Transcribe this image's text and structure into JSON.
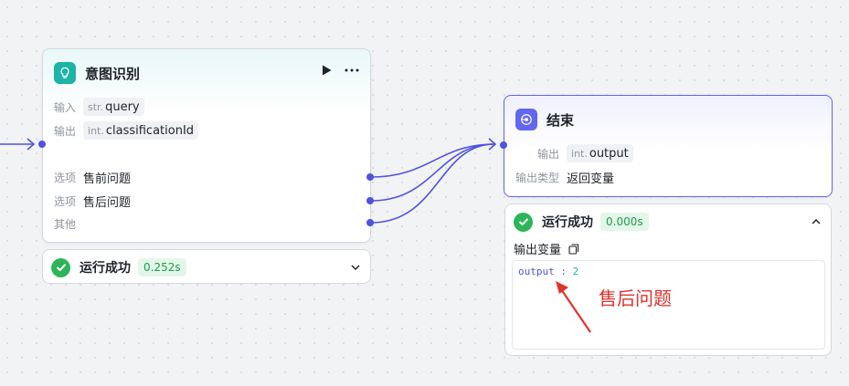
{
  "intent_node": {
    "title": "意图识别",
    "input": {
      "label": "输入",
      "type": "str.",
      "name": "query"
    },
    "output": {
      "label": "输出",
      "type": "int.",
      "name": "classificationId"
    },
    "options": [
      {
        "label": "选项",
        "value": "售前问题"
      },
      {
        "label": "选项",
        "value": "售后问题"
      },
      {
        "label": "其他",
        "value": ""
      }
    ],
    "icons": {
      "node": "bulb-icon",
      "run": "play-icon",
      "more": "more-icon"
    }
  },
  "intent_result": {
    "status": "运行成功",
    "time": "0.252s",
    "icons": {
      "status": "check-circle-icon",
      "toggle": "chevron-down-icon"
    }
  },
  "end_node": {
    "title": "结束",
    "output": {
      "label": "输出",
      "type": "int.",
      "name": "output"
    },
    "output_type": {
      "label": "输出类型",
      "value": "返回变量"
    },
    "icons": {
      "node": "end-icon"
    }
  },
  "end_result": {
    "status": "运行成功",
    "time": "0.000s",
    "output_label": "输出变量",
    "output_key": "output",
    "output_sep": " : ",
    "output_value": "2",
    "icons": {
      "status": "check-circle-icon",
      "toggle": "chevron-up-icon",
      "copy": "copy-icon"
    }
  },
  "annotation": {
    "text": "售后问题",
    "color": "#e0322b"
  },
  "colors": {
    "accent": "#4f52e0",
    "success": "#2fb45a",
    "intent_icon": "#1db3a7",
    "end_icon": "#6366f1"
  }
}
